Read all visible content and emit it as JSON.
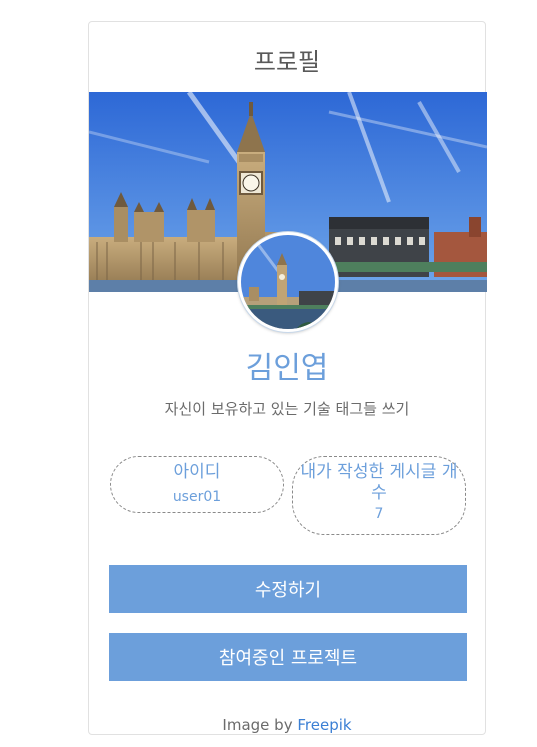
{
  "card": {
    "title": "프로필",
    "banner_image": "big-ben-london-landscape",
    "avatar_image": "big-ben-london-landscape",
    "name": "김인엽",
    "bio": "자신이 보유하고 있는 기술 태그들 쓰기"
  },
  "stats": {
    "id_label": "아이디",
    "id_value": "user01",
    "posts_label": "내가 작성한 게시글 개수",
    "posts_value": "7"
  },
  "buttons": {
    "edit_label": "수정하기",
    "projects_label": "참여중인 프로젝트"
  },
  "footer": {
    "credit_prefix": "Image by",
    "credit_link": "Freepik"
  },
  "colors": {
    "accent": "#6c9fdb",
    "text_muted": "#6b6b6b",
    "link": "#3b7fd4"
  }
}
